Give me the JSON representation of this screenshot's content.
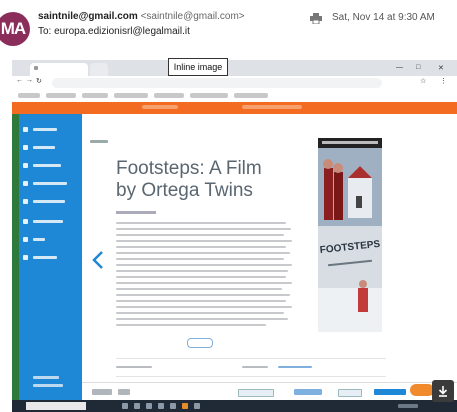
{
  "email": {
    "avatar_initials": "MA",
    "sender_email": "saintnile@gmail.com",
    "sender_full": "<saintnile@gmail.com>",
    "to_label": "To:",
    "to_address": "europa.edizionisrl@legalmail.it",
    "date": "Sat, Nov 14 at 9:30 AM"
  },
  "screenshot": {
    "tooltip": "Inline image",
    "article_title": "Footsteps: A Film by Ortega Twins",
    "poster_title": "FOOTSTEPS"
  },
  "colors": {
    "sidebar": "#1e88d6",
    "banner": "#f26b21",
    "avatar": "#8a2d5a",
    "desktop": "#2f7a3a"
  }
}
